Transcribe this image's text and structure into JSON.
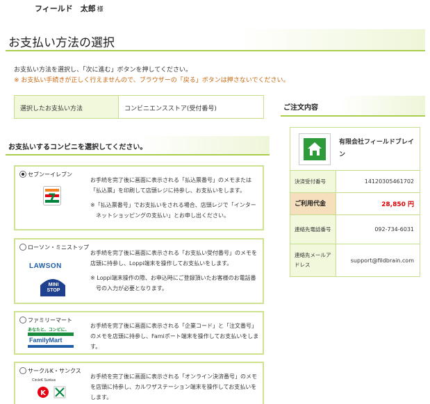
{
  "user": {
    "name": "フィールド　太郎",
    "honorific": "様"
  },
  "page": {
    "title": "お支払い方法の選択",
    "instruction": "お支払い方法を選択し、「次に進む」ボタンを押してください。",
    "warning": "※ お支払い手続きが正しく行えませんので、ブラウザーの「戻る」ボタンは押さないでください。"
  },
  "method": {
    "label": "選択したお支払い方法",
    "value": "コンビニエンスストア(受付番号)"
  },
  "section": {
    "title": "お支払いするコンビニを選択してください。"
  },
  "stores": [
    {
      "name": "セブンーイレブン",
      "selected": true,
      "desc": "お手続を完了後に画面に表示される「払込票番号」のメモまたは「払込票」を印刷して店頭レジに持参し、お支払いをします。",
      "note": "※「払込票番号」でお支払いをされる場合、店頭レジで「インターネットショッピングの支払い」とお申し出ください。",
      "logo_icon": "seven-eleven-logo-icon"
    },
    {
      "name": "ローソン・ミニストップ",
      "selected": false,
      "desc": "お手続を完了後に画面に表示される「お支払い受付番号」のメモを店頭に持参し、Loppi端末を操作してお支払いをします。",
      "note": "※ Loppi端末操作の際、お申込時にご登録頂いたお客様のお電話番号の入力が必要となります。",
      "logo_text_1": "LAWSON",
      "logo_text_2": "MINI",
      "logo_text_3": "STOP"
    },
    {
      "name": "ファミリーマート",
      "selected": false,
      "desc": "お手続を完了後に画面に表示される「企業コード」と「注文番号」のメモを店頭に持参し、Famiポート端末を操作してお支払いをします。",
      "logo_text_1": "あなたと、コンビに、",
      "logo_text_2": "FamilyMart"
    },
    {
      "name": "サークルK・サンクス",
      "selected": false,
      "desc": "お手続を完了後に画面に表示される「オンライン決済番号」のメモを店頭に持参し、カルワザステーション端末を操作してお支払いをします。",
      "logo_text_1": "CircleK Sunkus"
    }
  ],
  "order": {
    "title": "ご注文内容",
    "shop_name": "有限会社フィールドブレイン",
    "shop_icon": "home-icon",
    "rows": [
      {
        "label": "決済受付番号",
        "value": "14120305461702"
      },
      {
        "label": "ご利用代金",
        "value": "28,850 円"
      },
      {
        "label": "連絡先電話番号",
        "value": "092-734-6031"
      },
      {
        "label": "連絡先メールアドレス",
        "value": "support@fildbrain.com"
      }
    ]
  },
  "colors": {
    "accent_green": "#a9cc4a",
    "box_border": "#cde28f",
    "label_bg": "#f1f8dc",
    "total_bg": "#f6dfbd",
    "price_red": "#dd0000",
    "warning_orange": "#c8640a"
  }
}
